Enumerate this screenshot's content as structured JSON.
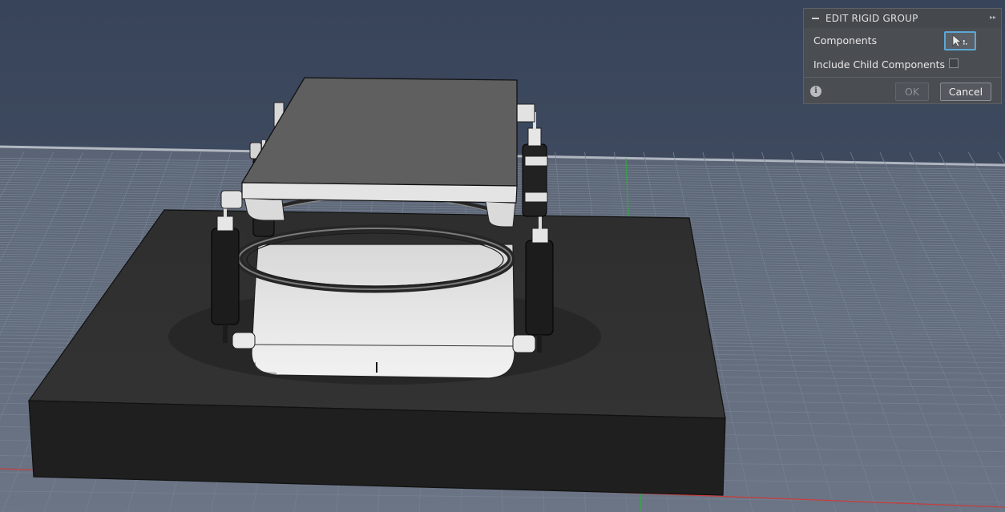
{
  "dialog": {
    "title": "EDIT RIGID GROUP",
    "components_label": "Components",
    "include_child_label": "Include Child Components",
    "include_child_checked": false,
    "ok_label": "OK",
    "cancel_label": "Cancel",
    "collapse_icon": "minus-icon",
    "expand_icon": "double-chevron-right-icon",
    "select_icon": "cursor-arrow-icon",
    "info_icon": "info-icon"
  },
  "colors": {
    "viewport_bg_top": "#3c4859",
    "grid_plane": "#5b6677",
    "grid_line": "#6e7a8c",
    "x_axis": "#c63e3e",
    "y_axis": "#3aa24a",
    "base_block": "#2a2a2a",
    "dialog_bg": "#4a4d52",
    "select_border": "#5ba8d6"
  }
}
